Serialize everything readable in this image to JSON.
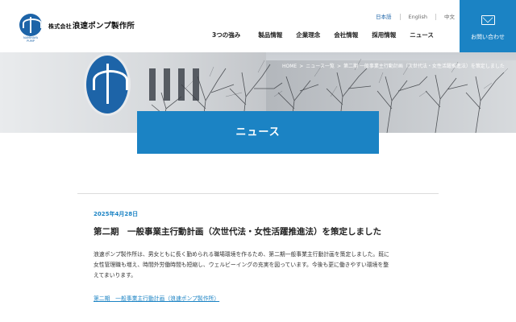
{
  "header": {
    "logo_sub": "NAMIHAYA PUMP",
    "logo_prefix": "株式会社",
    "logo_name": "浪速ポンプ製作所",
    "languages": [
      "日本語",
      "English",
      "中文"
    ],
    "nav": [
      "3つの強み",
      "製品情報",
      "企業理念",
      "会社情報",
      "採用情報",
      "ニュース"
    ],
    "contact_label": "お問い合わせ"
  },
  "hero": {
    "breadcrumb": [
      "HOME",
      ">",
      "ニュース一覧",
      ">",
      "第二期 一般事業主行動計画（次世代法・女性活躍推進法）を策定しました"
    ],
    "page_title": "ニュース"
  },
  "article": {
    "date": "2025年4月28日",
    "title": "第二期　一般事業主行動計画（次世代法・女性活躍推進法）を策定しました",
    "body_lines": [
      "浪速ポンプ製作所は、男女ともに長く勤められる職場環境を作るため、第二期一般事業主行動計画を策定しました。既に",
      "女性管理職も増え、時間外労働時間も短縮し、ウェルビーイングの充実を図っています。今後も更に働きやすい環境を整",
      "えてまいります。"
    ],
    "link": "第二期　一般事業主行動計画（浪速ポンプ製作所）"
  },
  "colors": {
    "accent": "#1b83c4",
    "brand": "#1d64a8"
  }
}
